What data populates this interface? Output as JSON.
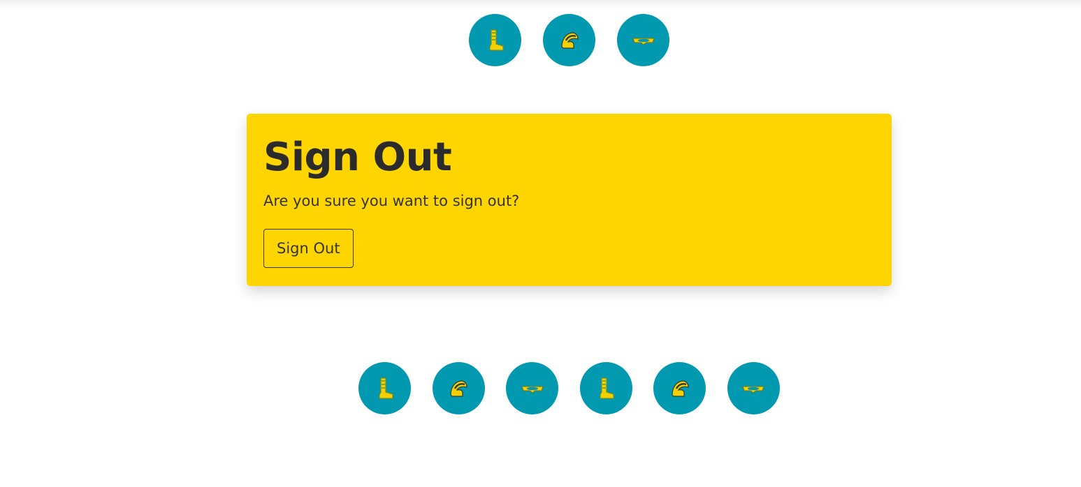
{
  "colors": {
    "accent": "#ffd500",
    "icon_circle": "#0099b0",
    "icon_fill": "#f4d000",
    "text": "#2b2b2b"
  },
  "top_gear_icons": [
    "boot-icon",
    "helmet-icon",
    "goggles-icon"
  ],
  "bottom_gear_icons": [
    "boot-icon",
    "helmet-icon",
    "goggles-icon",
    "boot-icon",
    "helmet-icon",
    "goggles-icon"
  ],
  "signout_card": {
    "title": "Sign Out",
    "message": "Are you sure you want to sign out?",
    "button_label": "Sign Out"
  }
}
